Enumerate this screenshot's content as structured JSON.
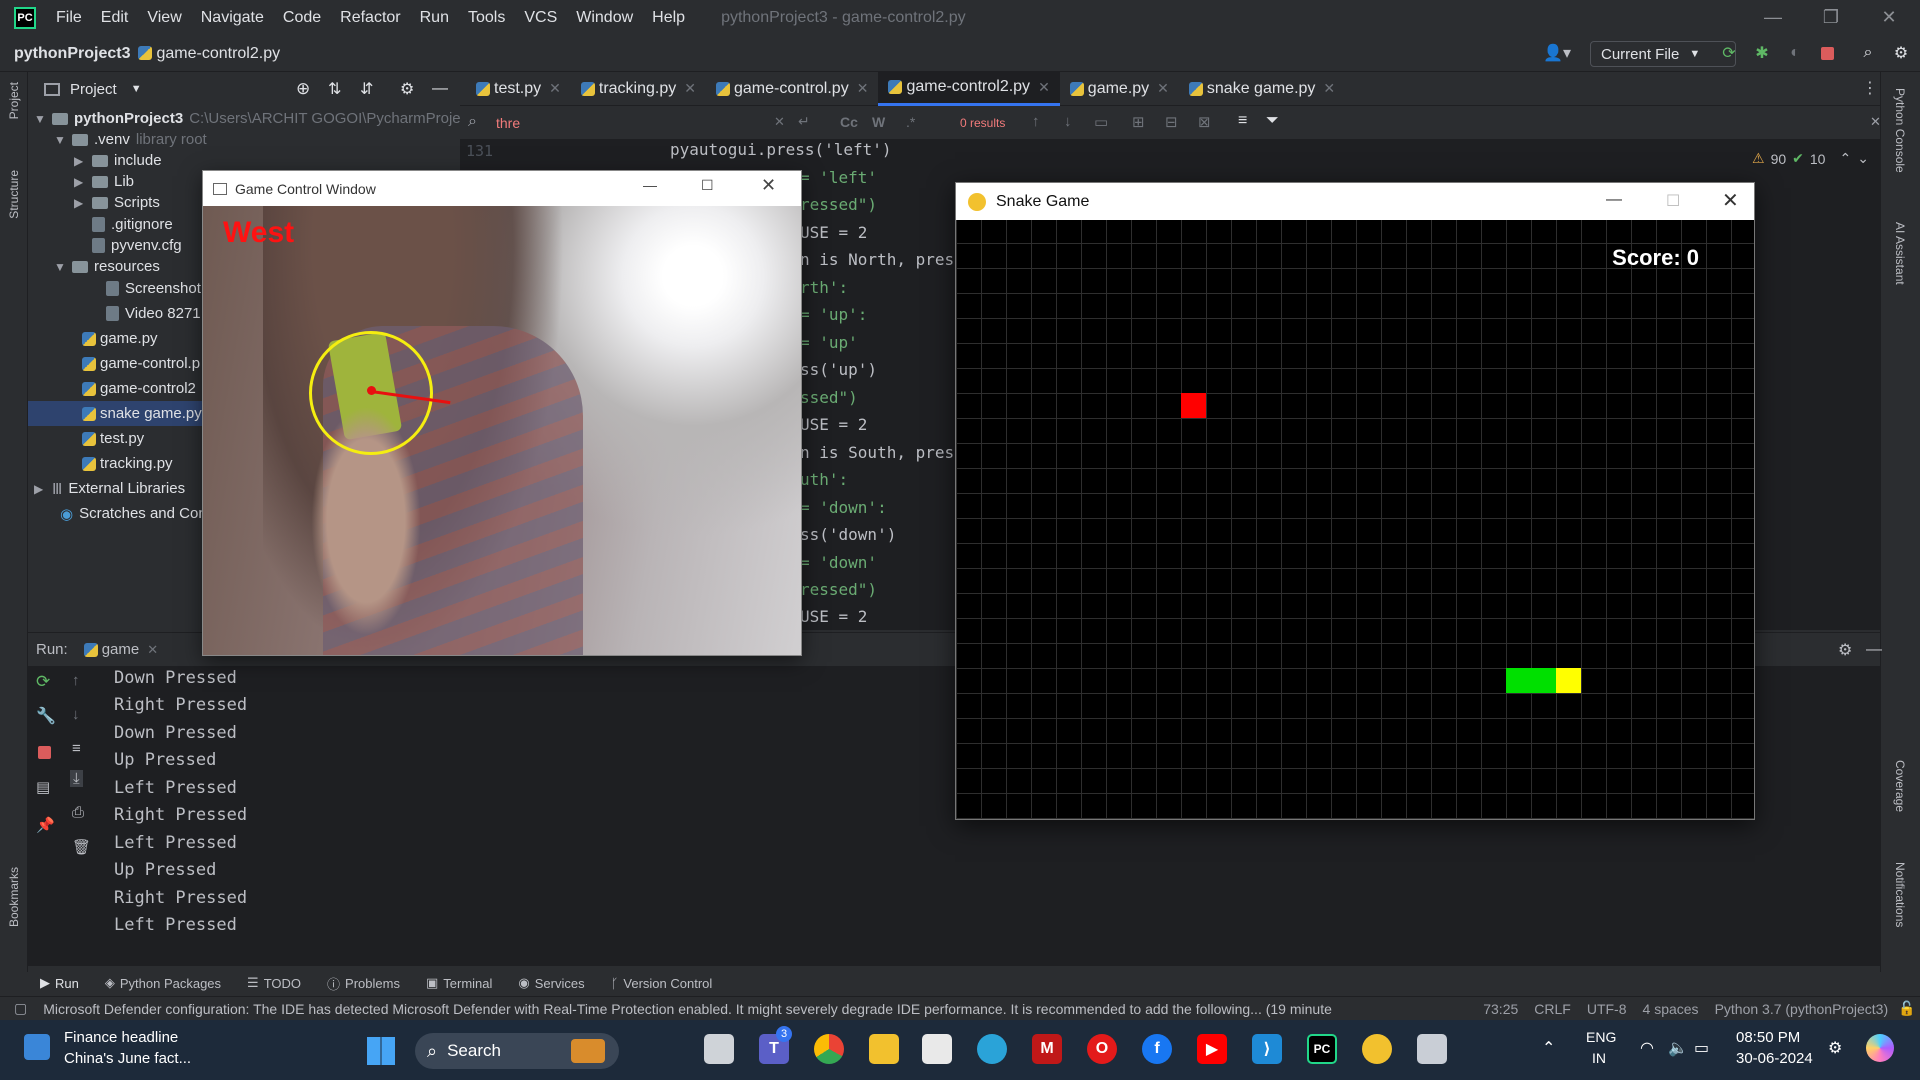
{
  "titlebar": {
    "menu": [
      "File",
      "Edit",
      "View",
      "Navigate",
      "Code",
      "Refactor",
      "Run",
      "Tools",
      "VCS",
      "Window",
      "Help"
    ],
    "window_title": "pythonProject3 - game-control2.py"
  },
  "navbar": {
    "project": "pythonProject3",
    "file": "game-control2.py",
    "run_config": "Current File"
  },
  "project_panel": {
    "title": "Project",
    "tree": [
      {
        "label": "pythonProject3",
        "hint": "C:\\Users\\ARCHIT GOGOI\\PycharmProjec"
      },
      {
        "label": ".venv",
        "hint": "library root"
      },
      {
        "label": "include"
      },
      {
        "label": "Lib"
      },
      {
        "label": "Scripts"
      },
      {
        "label": ".gitignore"
      },
      {
        "label": "pyvenv.cfg"
      },
      {
        "label": "resources"
      },
      {
        "label": "Screenshot"
      },
      {
        "label": "Video 8271"
      },
      {
        "label": "game.py"
      },
      {
        "label": "game-control.p"
      },
      {
        "label": "game-control2"
      },
      {
        "label": "snake game.py"
      },
      {
        "label": "test.py"
      },
      {
        "label": "tracking.py"
      },
      {
        "label": "External Libraries"
      },
      {
        "label": "Scratches and Con"
      }
    ]
  },
  "editor_tabs": [
    "test.py",
    "tracking.py",
    "game-control.py",
    "game-control2.py",
    "game.py",
    "snake game.py"
  ],
  "find": {
    "query": "thre",
    "results": "0 results",
    "case_btn": "Cc",
    "word_btn": "W",
    "regex_btn": ".*"
  },
  "editor": {
    "line_number": "131",
    "warnings": "90",
    "ok": "10",
    "lines": [
      "pyautogui.press('left')",
      "= 'left'",
      "ressed\")",
      "USE = 2",
      "n is North, pres",
      "rth':",
      "= 'up':",
      "= 'up'",
      "ss('up')",
      "ssed\")",
      "USE = 2",
      "n is South, pres",
      "uth':",
      "= 'down':",
      "ss('down')",
      "= 'down'",
      "ressed\")",
      "USE = 2"
    ]
  },
  "run_panel": {
    "label": "Run:",
    "tab": "game",
    "output": [
      "Down Pressed",
      "Right Pressed",
      "Down Pressed",
      "Up Pressed",
      "Left Pressed",
      "Right Pressed",
      "Left Pressed",
      "Up Pressed",
      "Right Pressed",
      "Left Pressed"
    ]
  },
  "bottom_tools": [
    "Run",
    "Python Packages",
    "TODO",
    "Problems",
    "Terminal",
    "Services",
    "Version Control"
  ],
  "status": {
    "message": "Microsoft Defender configuration: The IDE has detected Microsoft Defender with Real-Time Protection enabled. It might severely degrade IDE performance. It is recommended to add the following... (19 minute",
    "position": "73:25",
    "line_sep": "CRLF",
    "encoding": "UTF-8",
    "indent": "4 spaces",
    "interpreter": "Python 3.7 (pythonProject3)"
  },
  "side_labels": {
    "left": [
      "Project",
      "Structure",
      "Bookmarks"
    ],
    "right": [
      "Python Console",
      "AI Assistant",
      "Coverage",
      "Notifications"
    ]
  },
  "game_control": {
    "title": "Game Control Window",
    "direction": "West"
  },
  "snake_game": {
    "title": "Snake Game",
    "score": "Score: 0"
  },
  "taskbar": {
    "news_title": "Finance headline",
    "news_sub": "China's June fact...",
    "search": "Search",
    "teams_badge": "3",
    "lang1": "ENG",
    "lang2": "IN",
    "time": "08:50 PM",
    "date": "30-06-2024"
  },
  "colors": {
    "ide_bg": "#2b2d30",
    "editor_bg": "#1e1f22",
    "accent": "#3574f0",
    "snake_body": "#00e000",
    "snake_head": "#ffff00",
    "food": "#ff0000",
    "direction_text": "#ff1212"
  }
}
